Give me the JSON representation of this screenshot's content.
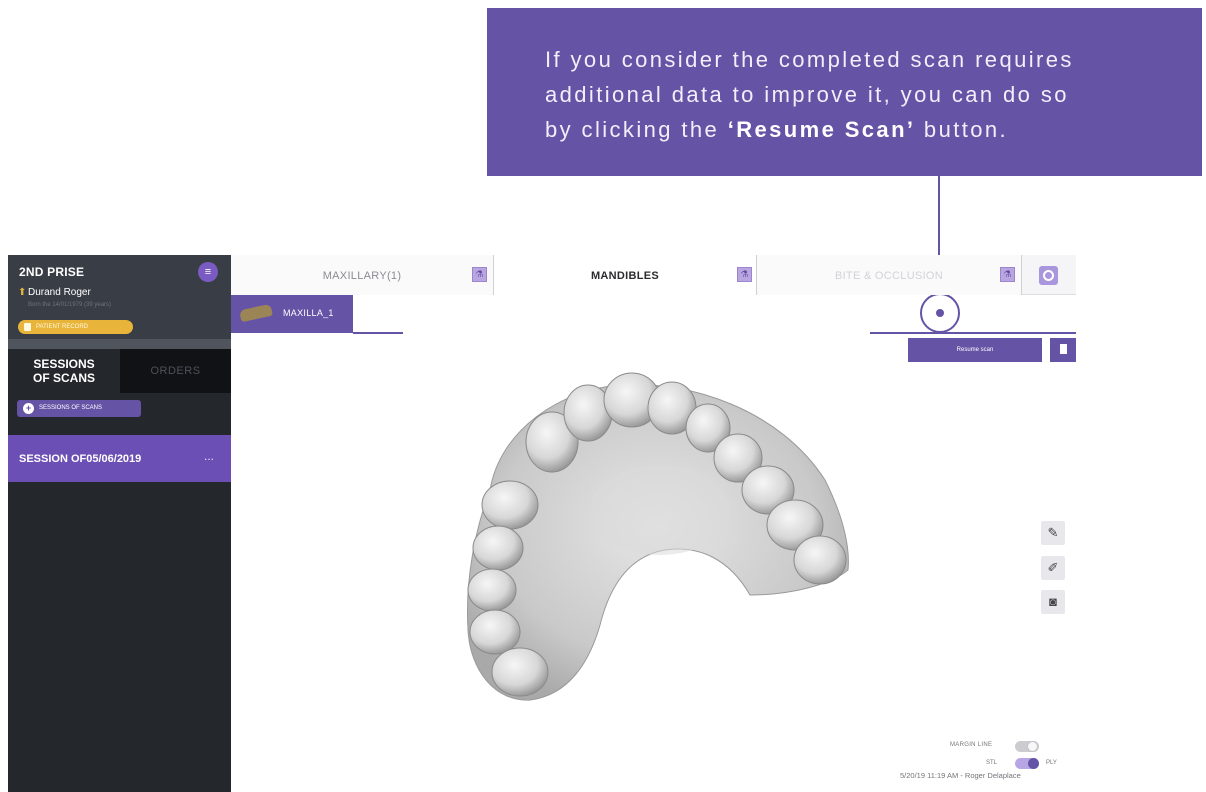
{
  "callout": {
    "line1": "If you consider the completed scan requires",
    "line2": "additional data to improve it, you can do so",
    "line3_prefix": "by clicking the ",
    "line3_bold": "‘Resume Scan’",
    "line3_suffix": " button."
  },
  "sidebar": {
    "title": "2ND PRISE",
    "patient_name": "Durand Roger",
    "patient_sub": "Born the 14/01/1979 (39 years)",
    "patient_record": "PATIENT RECORD",
    "tabs": [
      "SESSIONS\nOF SCANS",
      "ORDERS"
    ],
    "sessions_button": "SESSIONS OF SCANS",
    "session_item": "SESSION OF05/06/2019",
    "session_more": "..."
  },
  "tabs": {
    "maxillary": "MAXILLARY(1)",
    "mandibles": "MANDIBLES",
    "bite": "BITE & OCCLUSION"
  },
  "scan_tab": {
    "label": "MAXILLA_1"
  },
  "resume": {
    "label": "Resume scan"
  },
  "tools": {
    "pen": "pencil-icon",
    "edit": "edit-tool-icon",
    "camera": "camera-icon"
  },
  "footer": {
    "margin_line": "MARGIN LINE",
    "stl": "STL",
    "ply": "PLY",
    "stamp": "5/20/19 11:19 AM - Roger Delaplace"
  },
  "colors": {
    "accent": "#6553a6",
    "sidebar": "#24272c",
    "record": "#e8b53a"
  }
}
